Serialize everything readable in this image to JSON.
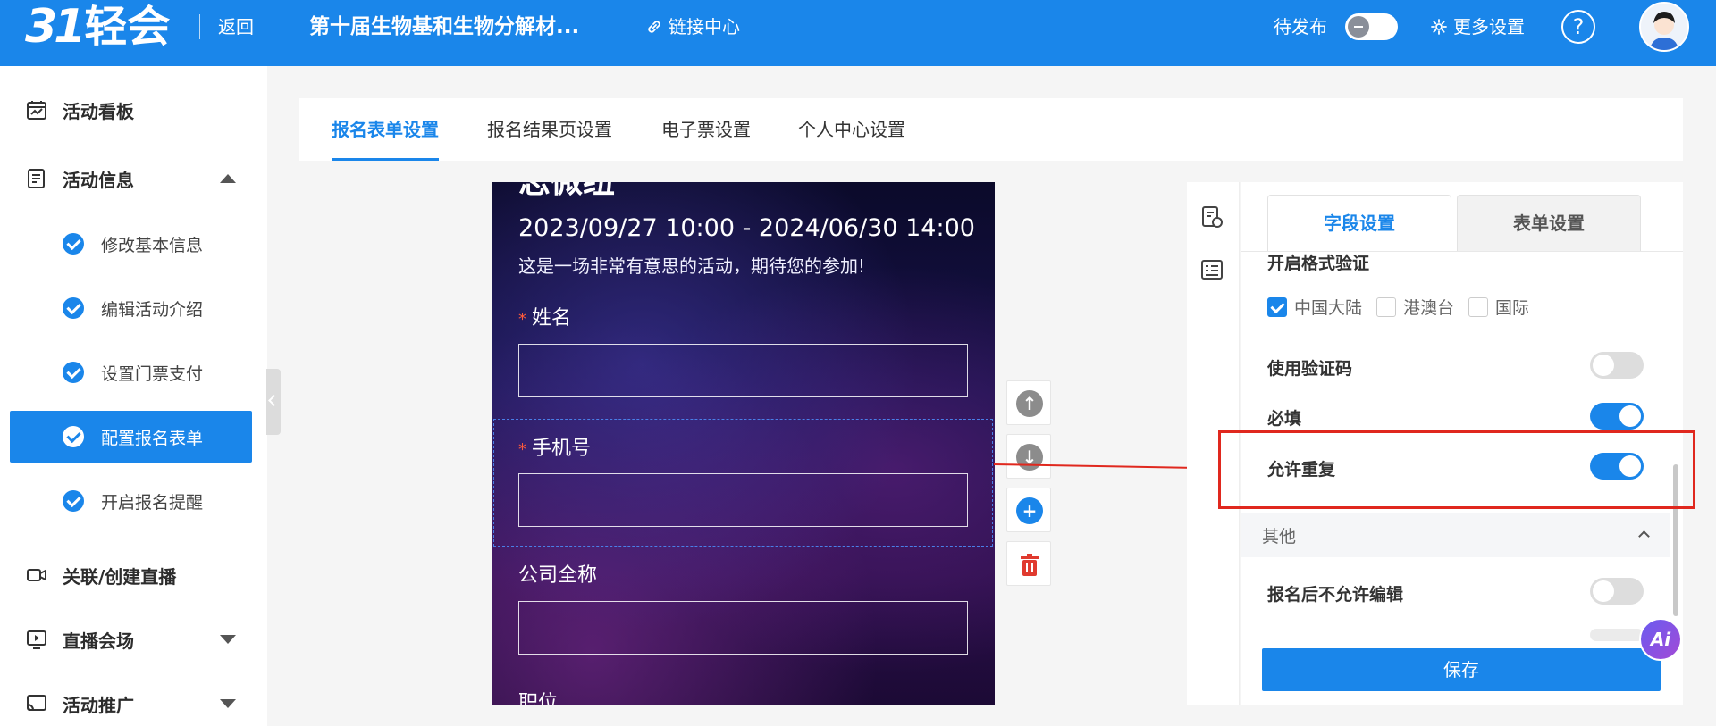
{
  "topbar": {
    "logo_mark": "31",
    "logo_text": "轻会",
    "back": "返回",
    "event_title": "第十届生物基和生物分解材...",
    "link_center": "链接中心",
    "status": "待发布",
    "more_settings": "更多设置",
    "help": "?"
  },
  "sidebar": {
    "dashboard": "活动看板",
    "info": "活动信息",
    "sub": [
      "修改基本信息",
      "编辑活动介绍",
      "设置门票支付",
      "配置报名表单",
      "开启报名提醒"
    ],
    "live": "关联/创建直播",
    "venue": "直播会场",
    "promo": "活动推广"
  },
  "tabs": [
    "报名表单设置",
    "报名结果页设置",
    "电子票设置",
    "个人中心设置"
  ],
  "preview": {
    "title": "志微纽",
    "dates": "2023/09/27 10:00 - 2024/06/30 14:00",
    "desc": "这是一场非常有意思的活动，期待您的参加!",
    "fields": [
      {
        "label": "姓名",
        "required": "*"
      },
      {
        "label": "手机号",
        "required": "*"
      },
      {
        "label": "公司全称"
      },
      {
        "label": "职位"
      }
    ]
  },
  "panel": {
    "tab_field": "字段设置",
    "tab_form": "表单设置",
    "format_check": "开启格式验证",
    "regions": [
      "中国大陆",
      "港澳台",
      "国际"
    ],
    "verify_code": "使用验证码",
    "required": "必填",
    "allow_dup": "允许重复",
    "other": "其他",
    "no_edit": "报名后不允许编辑",
    "save": "保存"
  },
  "ai_label": "Ai",
  "colors": {
    "brand": "#1a86ea",
    "annotation": "#e0281e"
  }
}
